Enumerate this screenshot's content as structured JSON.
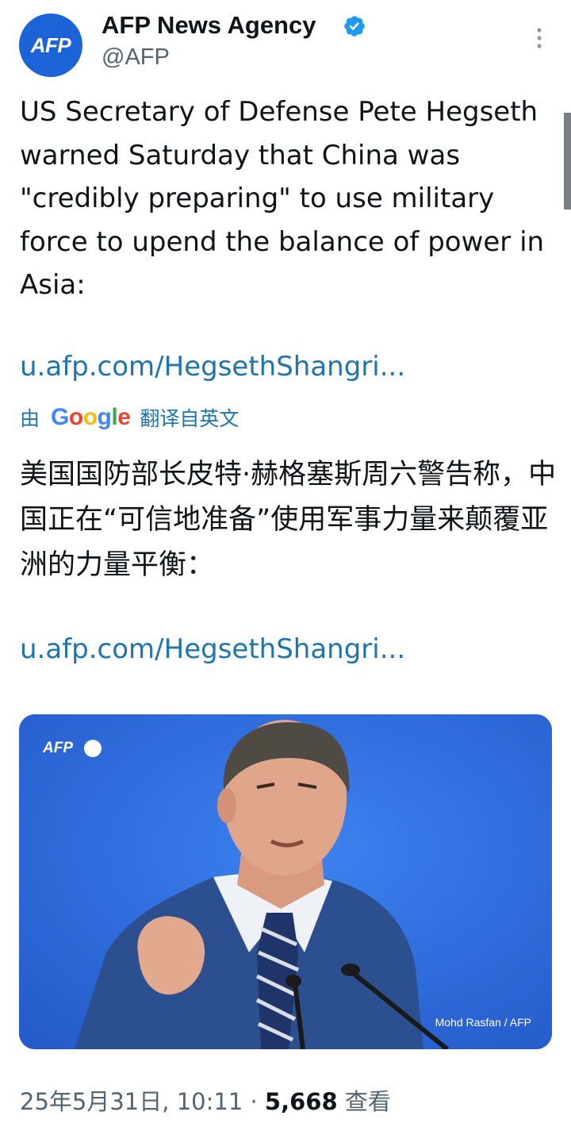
{
  "account": {
    "avatar_text": "AFP",
    "name": "AFP News Agency",
    "handle": "@AFP",
    "verified_icon": "verified-badge-icon",
    "brand_color": "#1d63d8"
  },
  "tweet": {
    "text_en": "US Secretary of Defense Pete Hegseth warned Saturday that China was \"credibly preparing\" to use military force to upend the balance of power in Asia:",
    "link_en": "u.afp.com/HegsethShangri...",
    "translate_prefix": "由",
    "translate_brand": "Google",
    "translate_suffix": "翻译自英文",
    "text_zh": "美国国防部长皮特·赫格塞斯周六警告称，中国正在“可信地准备”使用军事力量来颠覆亚洲的力量平衡：",
    "link_zh": "u.afp.com/HegsethShangri...",
    "link_color": "#1d74ae"
  },
  "media": {
    "watermark": "AFP",
    "credit": "Mohd Rasfan / AFP",
    "background_color": "#2f6fe0"
  },
  "meta": {
    "datetime": "25年5月31日, 10:11",
    "separator": "·",
    "views_count": "5,668",
    "views_label": "查看"
  }
}
